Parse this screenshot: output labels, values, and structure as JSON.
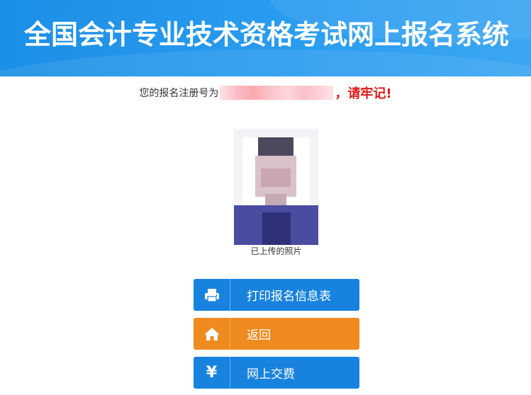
{
  "header": {
    "title": "全国会计专业技术资格考试网上报名系统"
  },
  "notice": {
    "prefix": "您的报名注册号为",
    "warning": "，请牢记!"
  },
  "photo": {
    "caption": "已上传的照片"
  },
  "buttons": [
    {
      "label": "打印报名信息表",
      "icon": "printer-icon",
      "color": "#1883df"
    },
    {
      "label": "返回",
      "icon": "home-icon",
      "color": "#ef8a1f"
    },
    {
      "label": "网上交费",
      "icon": "yen-icon",
      "glyph": "¥",
      "color": "#1883df"
    }
  ]
}
